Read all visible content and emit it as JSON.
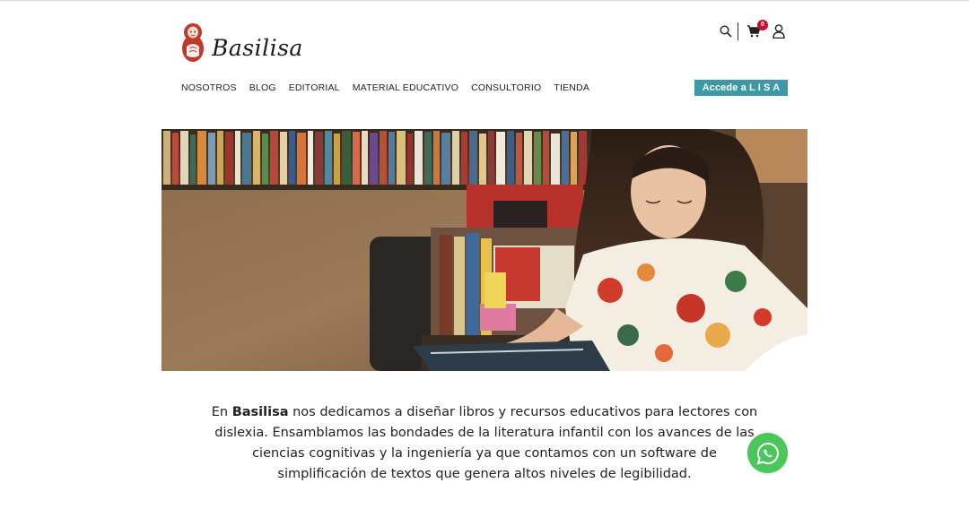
{
  "header": {
    "logo_text": "Basilisa",
    "icons": [
      "search-icon",
      "cart-icon",
      "user-icon"
    ],
    "cart_count": "0"
  },
  "nav": {
    "items": [
      {
        "label": "NOSOTROS"
      },
      {
        "label": "BLOG"
      },
      {
        "label": "EDITORIAL"
      },
      {
        "label": "MATERIAL EDUCATIVO"
      },
      {
        "label": "CONSULTORIO"
      },
      {
        "label": "TIENDA"
      }
    ],
    "cta_label": "Accede a L I S A"
  },
  "intro": {
    "prefix": "En ",
    "brand": "Basilisa",
    "text": " nos dedicamos a diseñar libros y recursos educativos para lectores con dislexia. Ensamblamos las bondades de la literatura infantil con los avances de las ciencias cognitivas y la ingeniería ya que contamos con un software de simplificación de textos que genera altos niveles de legibilidad."
  },
  "colors": {
    "accent": "#3c9aa6",
    "cart_badge": "#c8102e",
    "logo_red": "#c0392b",
    "whatsapp": "#4bc65b"
  }
}
